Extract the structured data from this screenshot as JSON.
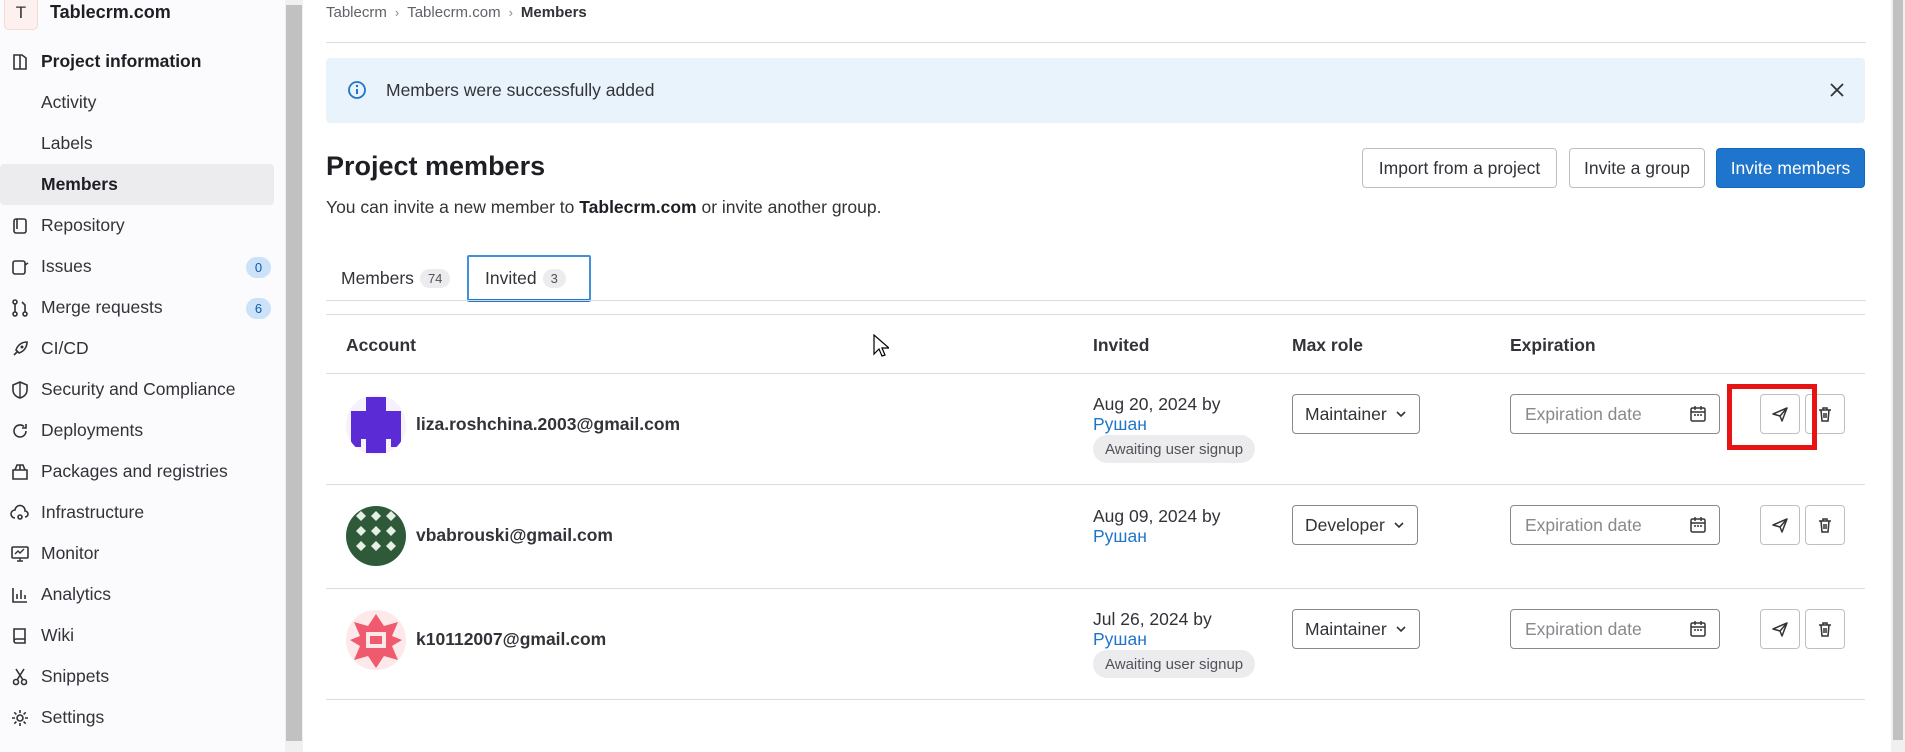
{
  "project": {
    "avatar_letter": "T",
    "name": "Tablecrm.com"
  },
  "sidebar": {
    "items": [
      {
        "label": "Project information",
        "icon": "project-info-icon",
        "bold": true
      },
      {
        "label": "Activity",
        "sub": true
      },
      {
        "label": "Labels",
        "sub": true
      },
      {
        "label": "Members",
        "sub": true,
        "active": true
      },
      {
        "label": "Repository",
        "icon": "repository-icon"
      },
      {
        "label": "Issues",
        "icon": "issues-icon",
        "count": "0"
      },
      {
        "label": "Merge requests",
        "icon": "merge-request-icon",
        "count": "6"
      },
      {
        "label": "CI/CD",
        "icon": "rocket-icon"
      },
      {
        "label": "Security and Compliance",
        "icon": "shield-icon"
      },
      {
        "label": "Deployments",
        "icon": "deployments-icon"
      },
      {
        "label": "Packages and registries",
        "icon": "package-icon"
      },
      {
        "label": "Infrastructure",
        "icon": "cloud-icon"
      },
      {
        "label": "Monitor",
        "icon": "monitor-icon"
      },
      {
        "label": "Analytics",
        "icon": "chart-icon"
      },
      {
        "label": "Wiki",
        "icon": "book-icon"
      },
      {
        "label": "Snippets",
        "icon": "scissors-icon"
      },
      {
        "label": "Settings",
        "icon": "gear-icon"
      }
    ]
  },
  "breadcrumb": {
    "items": [
      "Tablecrm",
      "Tablecrm.com"
    ],
    "current": "Members"
  },
  "alert": {
    "message": "Members were successfully added"
  },
  "page": {
    "title": "Project members",
    "subtitle_prefix": "You can invite a new member to ",
    "subtitle_project": "Tablecrm.com",
    "subtitle_suffix": " or invite another group."
  },
  "actions": {
    "import": "Import from a project",
    "invite_group": "Invite a group",
    "invite_members": "Invite members"
  },
  "tabs": [
    {
      "label": "Members",
      "count": "74"
    },
    {
      "label": "Invited",
      "count": "3",
      "active": true
    }
  ],
  "table": {
    "headers": {
      "account": "Account",
      "invited": "Invited",
      "max_role": "Max role",
      "expiration": "Expiration"
    },
    "rows": [
      {
        "email": "liza.roshchina.2003@gmail.com",
        "invited_date": "Aug 20, 2024 by",
        "invited_by": "Рушан",
        "status": "Awaiting user signup",
        "role": "Maintainer",
        "expiration_placeholder": "Expiration date"
      },
      {
        "email": "vbabrouski@gmail.com",
        "invited_date": "Aug 09, 2024 by",
        "invited_by": "Рушан",
        "status": "",
        "role": "Developer",
        "expiration_placeholder": "Expiration date"
      },
      {
        "email": "k10112007@gmail.com",
        "invited_date": "Jul 26, 2024 by",
        "invited_by": "Рушан",
        "status": "Awaiting user signup",
        "role": "Maintainer",
        "expiration_placeholder": "Expiration date"
      }
    ]
  },
  "colors": {
    "primary": "#1f75cb",
    "highlight": "#e81313",
    "alert_bg": "#e9f3fc"
  }
}
